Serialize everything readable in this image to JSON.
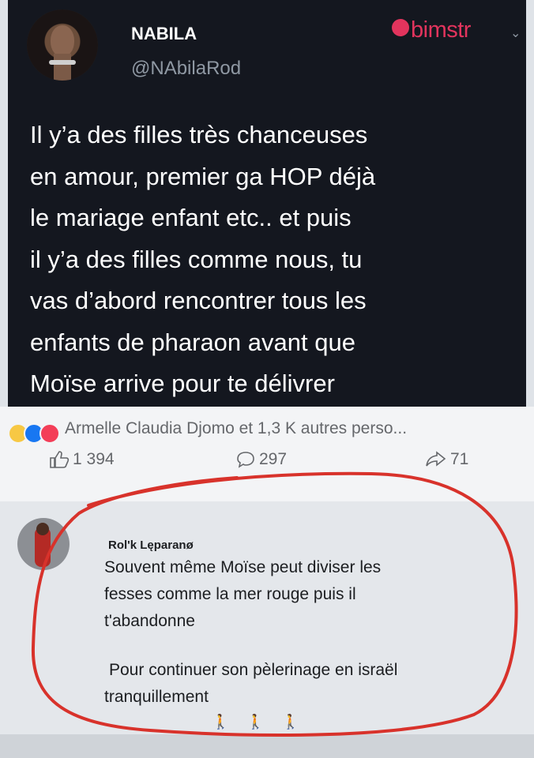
{
  "tweet": {
    "author_name": "NABILA",
    "handle": "@NAbilaRod",
    "watermark": "bimstr",
    "text_lines": [
      "Il y’a des filles très chanceuses",
      "en amour, premier ga HOP déjà",
      "le mariage enfant etc.. et puis",
      "il y’a des filles comme nous, tu",
      "vas d’abord rencontrer tous les",
      "enfants de pharaon avant que",
      "Moïse arrive pour  te délivrer"
    ]
  },
  "reactions": {
    "summary": "Armelle Claudia Djomo et 1,3 K autres perso...",
    "icons": [
      "laugh-icon",
      "like-icon",
      "love-icon"
    ],
    "like_count": "1 394",
    "comment_count": "297",
    "share_count": "71"
  },
  "comment": {
    "author": "Rol'k Lęparanø",
    "text_lines": [
      "Souvent même Moïse peut diviser les",
      "fesses comme la mer rouge puis il",
      "t'abandonne"
    ],
    "text_lines_2": [
      "Pour continuer son pèlerinage en israël",
      "tranquillement"
    ],
    "emojis": [
      "🚶",
      "🚶",
      "🚶"
    ]
  },
  "colors": {
    "tweet_bg": "#14171f",
    "brand_pink": "#e2345d",
    "annotation_red": "#d8322b",
    "fb_gray": "#65676b"
  }
}
